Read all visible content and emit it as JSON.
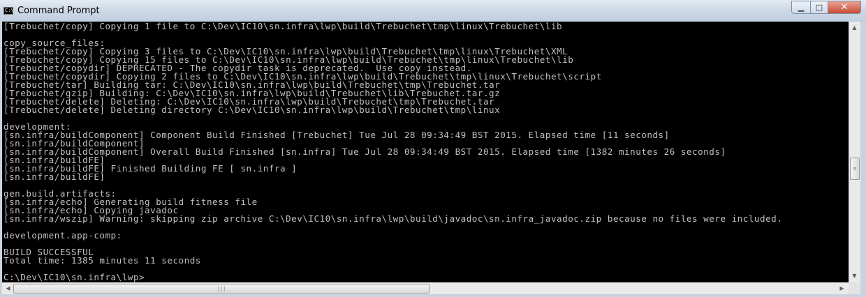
{
  "window": {
    "title": "Command Prompt",
    "icon": "cmd-icon",
    "icon_text": "C:\\",
    "minimize_glyph": "▁",
    "maximize_glyph": "□",
    "close_glyph": "✕"
  },
  "colors": {
    "console_background": "#000000",
    "console_text": "#c0c0c0",
    "title_bar": "#cdd8e5",
    "close_button": "#c94b33"
  },
  "console": {
    "lines": [
      "[Trebuchet/copy] Copying 1 file to C:\\Dev\\IC10\\sn.infra\\lwp\\build\\Trebuchet\\tmp\\linux\\Trebuchet\\lib",
      "",
      "copy_source_files:",
      "[Trebuchet/copy] Copying 3 files to C:\\Dev\\IC10\\sn.infra\\lwp\\build\\Trebuchet\\tmp\\linux\\Trebuchet\\XML",
      "[Trebuchet/copy] Copying 15 files to C:\\Dev\\IC10\\sn.infra\\lwp\\build\\Trebuchet\\tmp\\linux\\Trebuchet\\lib",
      "[Trebuchet/copydir] DEPRECATED - The copydir task is deprecated.  Use copy instead.",
      "[Trebuchet/copydir] Copying 2 files to C:\\Dev\\IC10\\sn.infra\\lwp\\build\\Trebuchet\\tmp\\linux\\Trebuchet\\script",
      "[Trebuchet/tar] Building tar: C:\\Dev\\IC10\\sn.infra\\lwp\\build\\Trebuchet\\tmp\\Trebuchet.tar",
      "[Trebuchet/gzip] Building: C:\\Dev\\IC10\\sn.infra\\lwp\\build\\Trebuchet\\lib\\Trebuchet.tar.gz",
      "[Trebuchet/delete] Deleting: C:\\Dev\\IC10\\sn.infra\\lwp\\build\\Trebuchet\\tmp\\Trebuchet.tar",
      "[Trebuchet/delete] Deleting directory C:\\Dev\\IC10\\sn.infra\\lwp\\build\\Trebuchet\\tmp\\linux",
      "",
      "development:",
      "[sn.infra/buildComponent] Component Build Finished [Trebuchet] Tue Jul 28 09:34:49 BST 2015. Elapsed time [11 seconds]",
      "[sn.infra/buildComponent]",
      "[sn.infra/buildComponent] Overall Build Finished [sn.infra] Tue Jul 28 09:34:49 BST 2015. Elapsed time [1382 minutes 26 seconds]",
      "[sn.infra/buildFE]",
      "[sn.infra/buildFE] Finished Building FE [ sn.infra ]",
      "[sn.infra/buildFE]",
      "",
      "gen.build.artifacts:",
      "[sn.infra/echo] Generating build fitness file",
      "[sn.infra/echo] Copying javadoc",
      "[sn.infra/wszip] Warning: skipping zip archive C:\\Dev\\IC10\\sn.infra\\lwp\\build\\javadoc\\sn.infra_javadoc.zip because no files were included.",
      "",
      "development.app-comp:",
      "",
      "BUILD SUCCESSFUL",
      "Total time: 1385 minutes 11 seconds",
      "",
      "C:\\Dev\\IC10\\sn.infra\\lwp>"
    ]
  },
  "scrollbars": {
    "up_arrow": "▲",
    "down_arrow": "▼",
    "left_arrow": "◀",
    "right_arrow": "▶",
    "grip": "≡",
    "hgrip": "|||"
  }
}
